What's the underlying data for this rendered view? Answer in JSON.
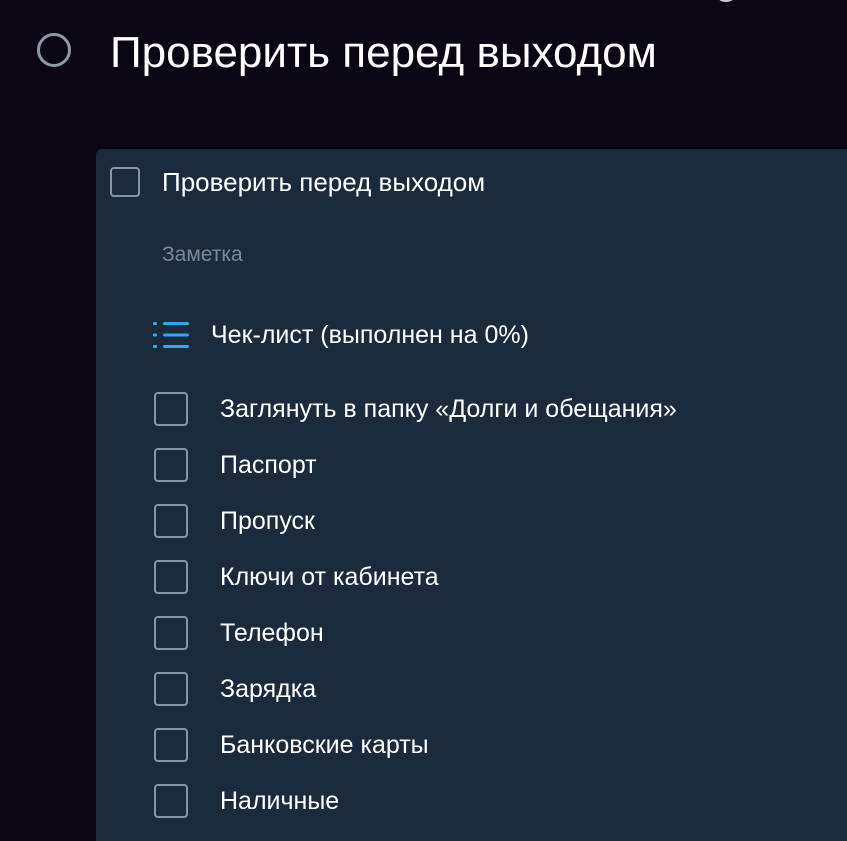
{
  "task": {
    "title": "Проверить перед выходом"
  },
  "card": {
    "title": "Проверить перед выходом",
    "note_placeholder": "Заметка",
    "checklist": {
      "title": "Чек-лист (выполнен на 0%)",
      "progress_percent": 0,
      "items": [
        {
          "label": "Заглянуть в папку «Долги и обещания»",
          "checked": false
        },
        {
          "label": "Паспорт",
          "checked": false
        },
        {
          "label": "Пропуск",
          "checked": false
        },
        {
          "label": "Ключи от кабинета",
          "checked": false
        },
        {
          "label": "Телефон",
          "checked": false
        },
        {
          "label": "Зарядка",
          "checked": false
        },
        {
          "label": "Банковские карты",
          "checked": false
        },
        {
          "label": "Наличные",
          "checked": false
        }
      ]
    }
  },
  "colors": {
    "background": "#0c0614",
    "card": "#1c2a3e",
    "accent": "#2fa8f2",
    "checkbox_border": "#8a96a3",
    "muted_text": "#7c8896"
  },
  "icons": {
    "task_status": "circle-icon",
    "checklist": "list-icon"
  }
}
